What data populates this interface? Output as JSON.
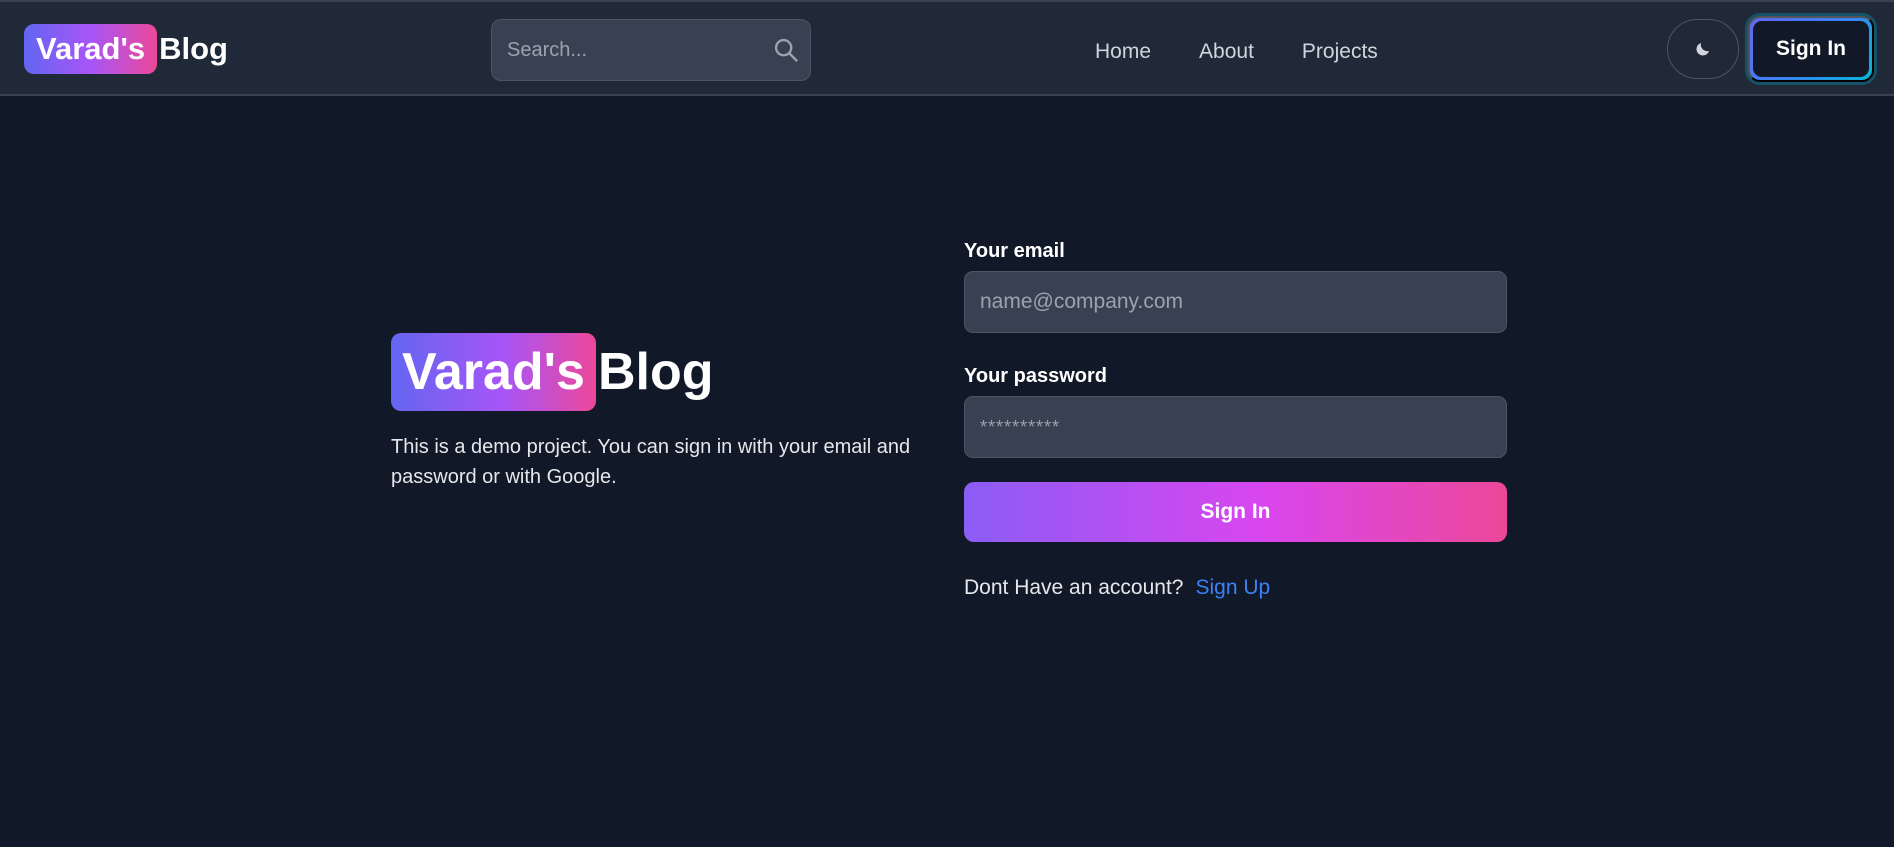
{
  "navbar": {
    "brand": {
      "highlight": "Varad's",
      "rest": "Blog"
    },
    "search": {
      "placeholder": "Search...",
      "icon": "search-icon"
    },
    "links": [
      {
        "label": "Home"
      },
      {
        "label": "About"
      },
      {
        "label": "Projects"
      }
    ],
    "theme_toggle": {
      "icon": "moon-icon"
    },
    "signin_label": "Sign In"
  },
  "main": {
    "brand": {
      "highlight": "Varad's",
      "rest": "Blog"
    },
    "intro": "This is a demo project. You can sign in with your email and password or with Google.",
    "form": {
      "email_label": "Your email",
      "email_placeholder": "name@company.com",
      "email_value": "",
      "password_label": "Your password",
      "password_placeholder": "**********",
      "password_value": "",
      "submit_label": "Sign In",
      "signup_prompt": "Dont Have an account?",
      "signup_link": "Sign Up"
    }
  },
  "colors": {
    "background": "#111827",
    "navbar": "#1f2937",
    "input": "#374151",
    "gradient_start": "#6366f1",
    "gradient_end": "#ec4899",
    "link": "#3b82f6"
  }
}
